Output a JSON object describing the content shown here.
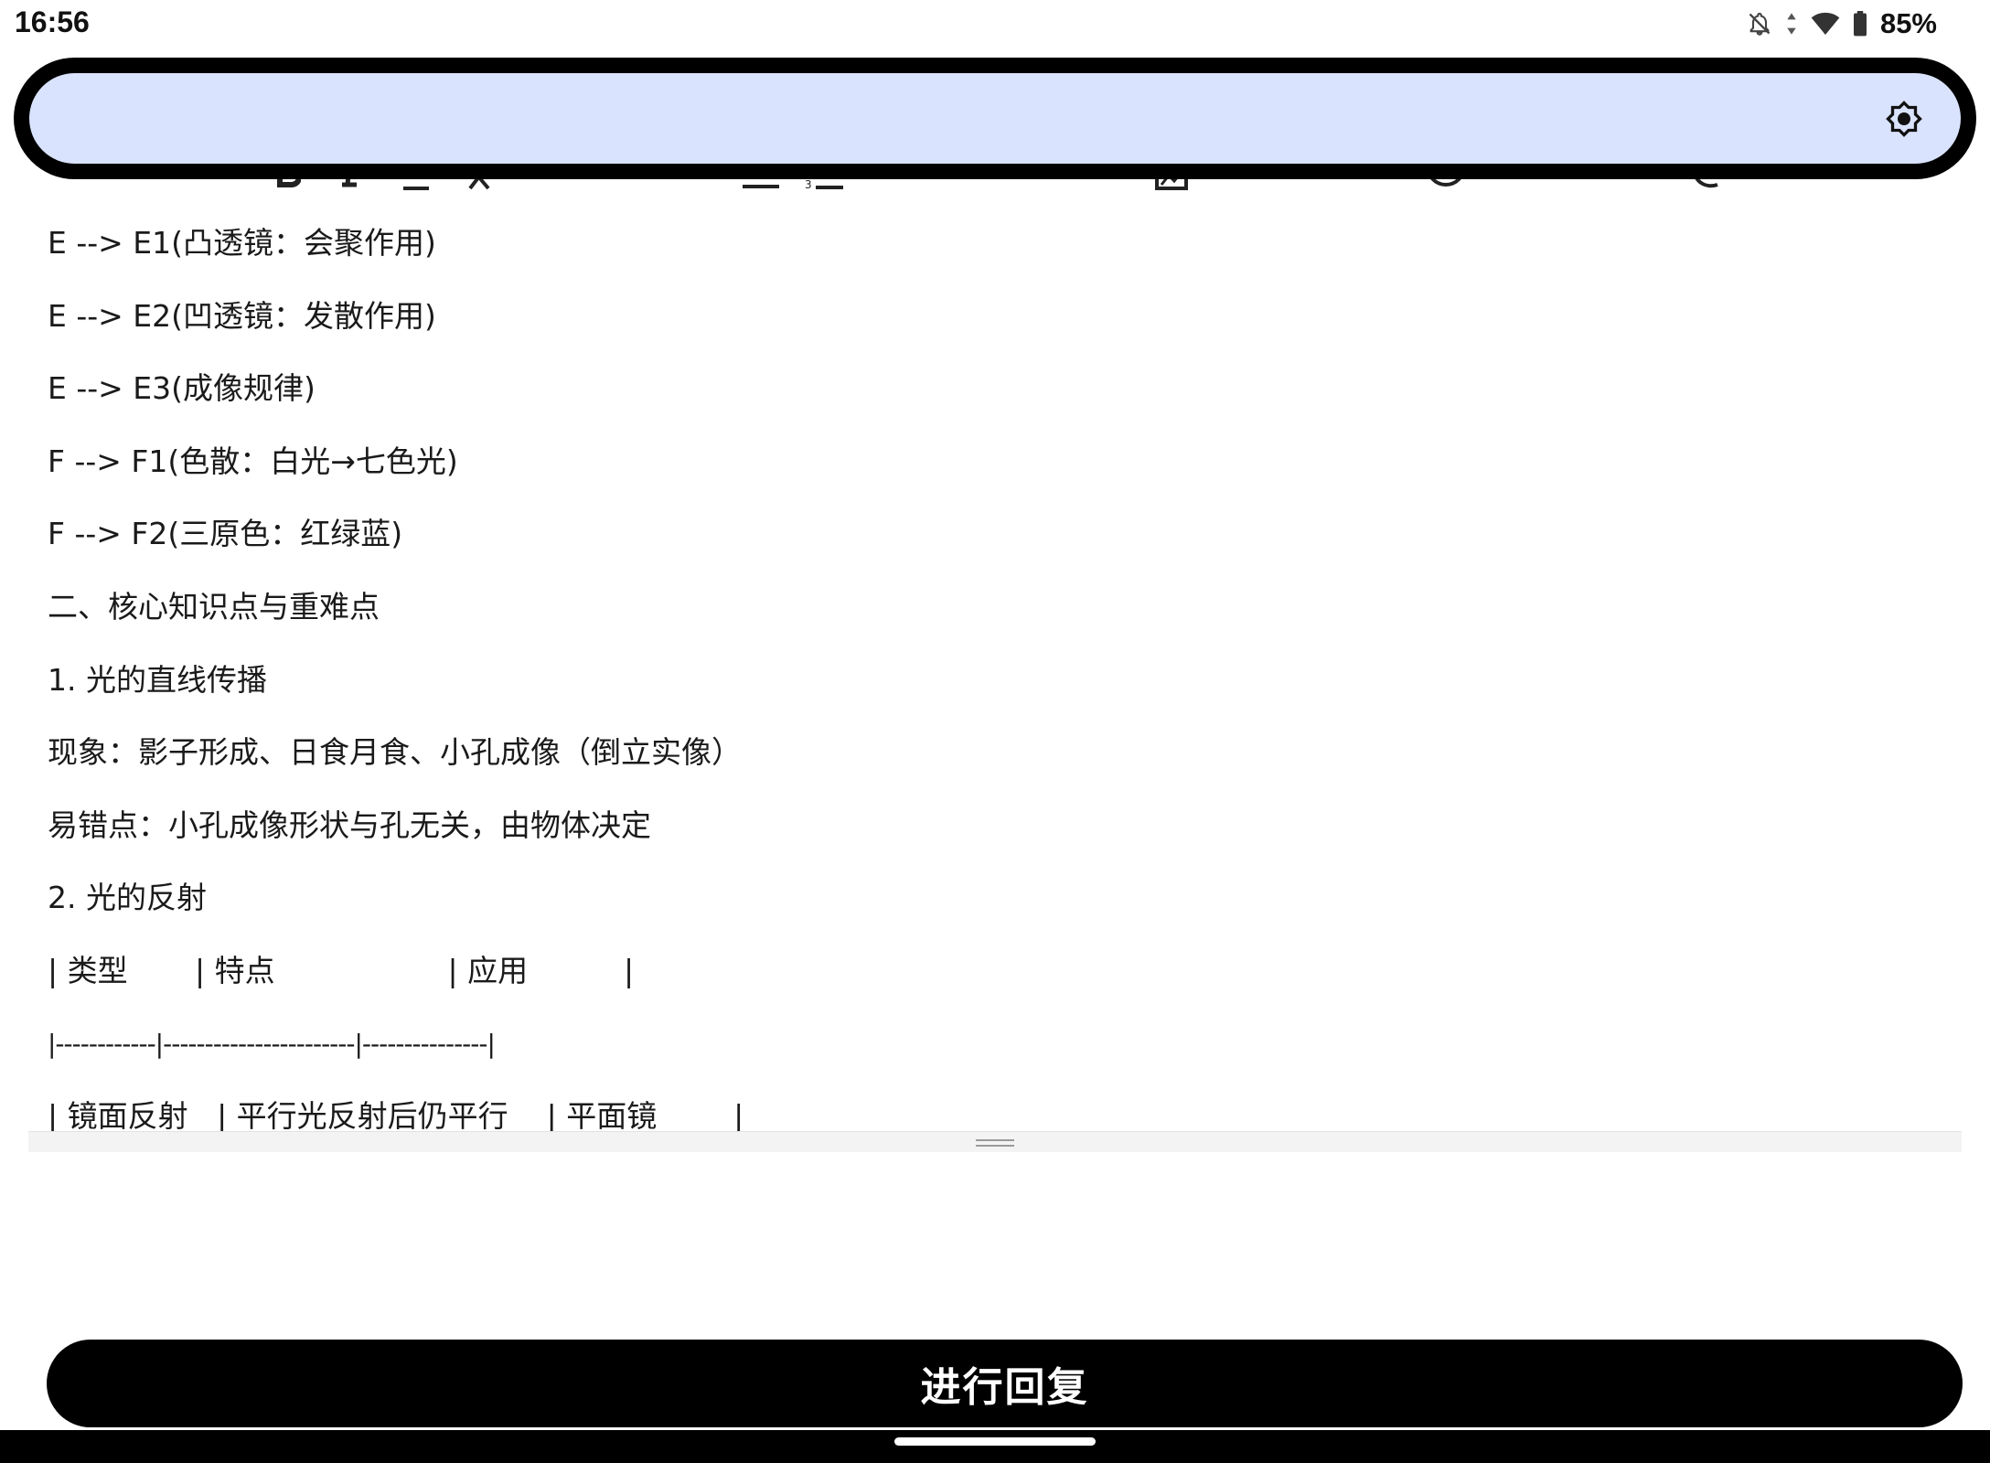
{
  "status_bar": {
    "time": "16:56",
    "battery": "85%",
    "icons": [
      "notifications-off-icon",
      "data-arrows-icon",
      "wifi-icon",
      "battery-icon"
    ]
  },
  "floating_bar": {
    "background_color": "#d9e3fd",
    "icon": "brightness-icon"
  },
  "toolbar": {
    "icons": [
      "bold-icon",
      "italic-icon",
      "underline-icon",
      "clear-format-icon",
      "bullet-list-icon",
      "numbered-list-icon",
      "link-icon",
      "image-icon",
      "emoji-icon",
      "mention-icon"
    ]
  },
  "editor": {
    "lines": [
      "E --> E1(凸透镜：会聚作用)",
      "E --> E2(凹透镜：发散作用)",
      "E --> E3(成像规律)",
      "F --> F1(色散：白光→七色光)",
      "F --> F2(三原色：红绿蓝)",
      "二、核心知识点与重难点",
      "1. 光的直线传播",
      "现象：影子形成、日食月食、小孔成像（倒立实像）",
      "易错点：小孔成像形状与孔无关，由物体决定",
      "2. 光的反射",
      "| 类型       | 特点                  | 应用          |",
      "|------------|-----------------------|---------------|",
      "| 镜面反射   | 平行光反射后仍平行    | 平面镜        |"
    ]
  },
  "reply_button": {
    "label": "进行回复"
  }
}
